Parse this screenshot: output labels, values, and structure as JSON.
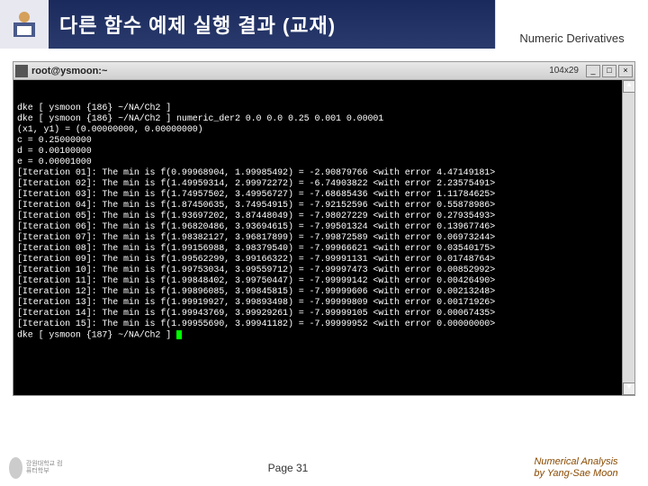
{
  "header": {
    "title": "다른 함수 예제 실행 결과 (교재)",
    "right": "Numeric Derivatives"
  },
  "terminal": {
    "title": "root@ysmoon:~",
    "size": "104x29",
    "prompt1": "dke [ ysmoon {186} ~/NA/Ch2 ]",
    "cmd": "dke [ ysmoon {186} ~/NA/Ch2 ] numeric_der2 0.0 0.0 0.25 0.001 0.00001",
    "init_line": "(x1, y1) = (0.00000000, 0.00000000)",
    "c_line": "c = 0.25000000",
    "d_line": "d = 0.00100000",
    "e_line": "e = 0.00001000",
    "iter": [
      "[Iteration 01]: The min is f(0.99968904, 1.99985492) = -2.90879766 <with error 4.47149181>",
      "[Iteration 02]: The min is f(1.49959314, 2.99972272) = -6.74903822 <with error 2.23575491>",
      "[Iteration 03]: The min is f(1.74957502, 3.49956727) = -7.68685436 <with error 1.11784625>",
      "[Iteration 04]: The min is f(1.87450635, 3.74954915) = -7.92152596 <with error 0.55878986>",
      "[Iteration 05]: The min is f(1.93697202, 3.87448049) = -7.98027229 <with error 0.27935493>",
      "[Iteration 06]: The min is f(1.96820486, 3.93694615) = -7.99501324 <with error 0.13967746>",
      "[Iteration 07]: The min is f(1.98382127, 3.96817899) = -7.99872589 <with error 0.06973244>",
      "[Iteration 08]: The min is f(1.99156988, 3.98379540) = -7.99966621 <with error 0.03540175>",
      "[Iteration 09]: The min is f(1.99562299, 3.99166322) = -7.99991131 <with error 0.01748764>",
      "[Iteration 10]: The min is f(1.99753034, 3.99559712) = -7.99997473 <with error 0.00852992>",
      "[Iteration 11]: The min is f(1.99848402, 3.99750447) = -7.99999142 <with error 0.00426490>",
      "[Iteration 12]: The min is f(1.99896085, 3.99845815) = -7.99999606 <with error 0.00213248>",
      "[Iteration 13]: The min is f(1.99919927, 3.99893498) = -7.99999809 <with error 0.00171926>",
      "[Iteration 14]: The min is f(1.99943769, 3.99929261) = -7.99999105 <with error 0.00067435>",
      "[Iteration 15]: The min is f(1.99955690, 3.99941182) = -7.99999952 <with error 0.00000000>"
    ],
    "prompt2": "dke [ ysmoon {187} ~/NA/Ch2 ] "
  },
  "footer": {
    "logo_text": "강원대학교\n컴퓨터학부",
    "page": "Page 31",
    "credit1": "Numerical Analysis",
    "credit2": "by Yang-Sae Moon"
  }
}
